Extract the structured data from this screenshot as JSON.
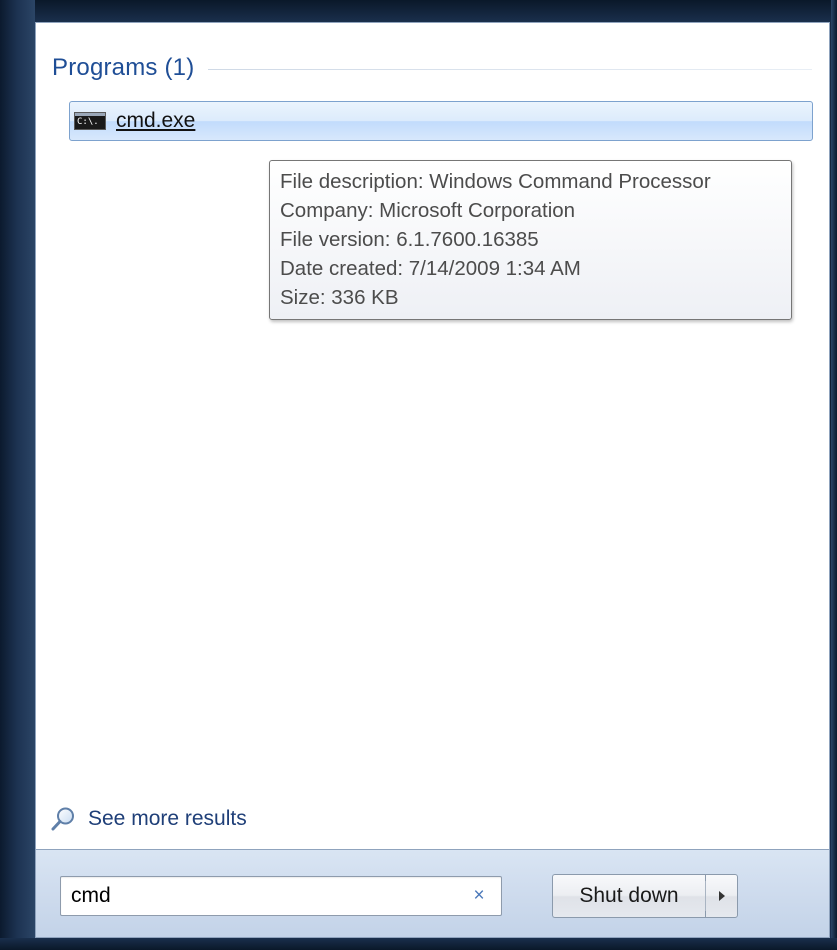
{
  "programs_section": {
    "title": "Programs (1)"
  },
  "results": [
    {
      "label": "cmd.exe",
      "icon": "command-prompt-icon",
      "icon_text": "C:\\."
    }
  ],
  "tooltip": {
    "lines": [
      "File description: Windows Command Processor",
      "Company: Microsoft Corporation",
      "File version: 6.1.7600.16385",
      "Date created: 7/14/2009 1:34 AM",
      "Size: 336 KB"
    ]
  },
  "see_more": {
    "label": "See more results",
    "icon": "magnifier-icon"
  },
  "search": {
    "value": "cmd",
    "clear_glyph": "×"
  },
  "shutdown": {
    "label": "Shut down"
  },
  "colors": {
    "section_title": "#1f4e96",
    "link": "#1f3f78",
    "clear_x": "#4b78b9",
    "selection_border": "#7da2ce"
  }
}
